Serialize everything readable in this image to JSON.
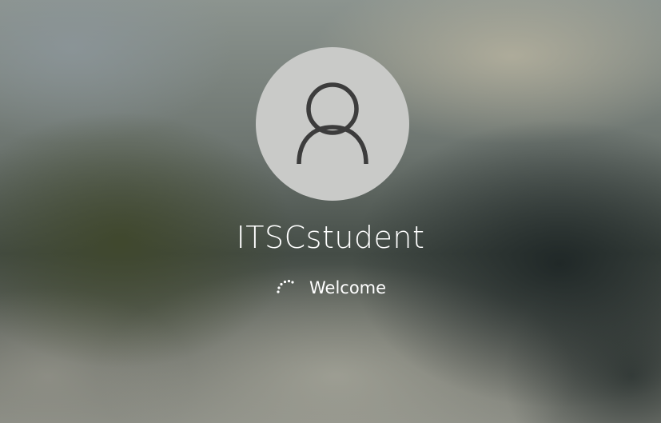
{
  "login": {
    "username": "ITSCstudent",
    "status": "Welcome"
  },
  "icons": {
    "avatar": "user-silhouette-icon",
    "spinner": "loading-spinner-icon"
  },
  "colors": {
    "text": "#ffffff",
    "avatar_background": "#c9cac8",
    "avatar_glyph": "#3c3c3c"
  }
}
